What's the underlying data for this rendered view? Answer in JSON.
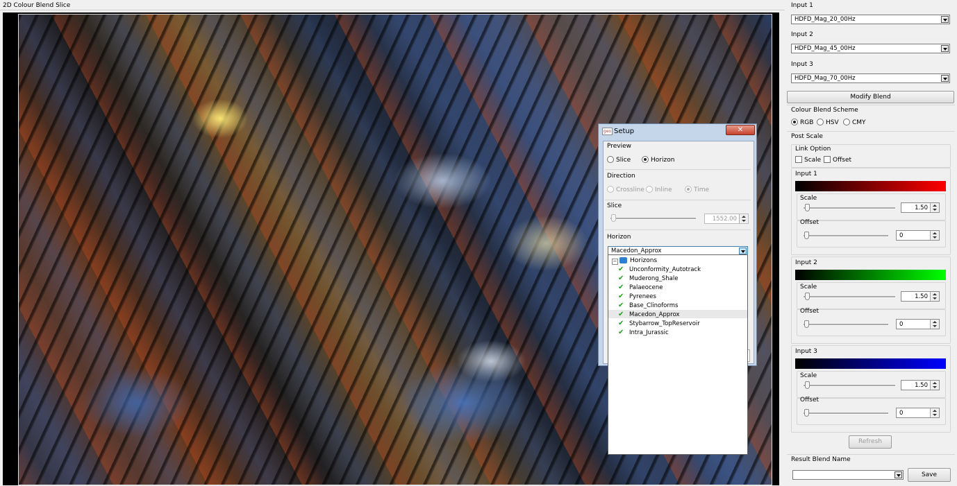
{
  "viewer": {
    "title": "2D Colour Blend Slice"
  },
  "inputs": [
    {
      "label": "Input 1",
      "value": "HDFD_Mag_20_00Hz"
    },
    {
      "label": "Input 2",
      "value": "HDFD_Mag_45_00Hz"
    },
    {
      "label": "Input 3",
      "value": "HDFD_Mag_70_00Hz"
    }
  ],
  "modify_blend": "Modify Blend",
  "scheme": {
    "title": "Colour Blend Scheme",
    "options": [
      "RGB",
      "HSV",
      "CMY"
    ],
    "selected": "RGB"
  },
  "post_scale": {
    "title": "Post Scale",
    "link_option": {
      "title": "Link Option",
      "scale": "Scale",
      "offset": "Offset"
    },
    "channels": [
      {
        "label": "Input 1",
        "scale_label": "Scale",
        "scale": "1.50",
        "offset_label": "Offset",
        "offset": "0",
        "color": "#ff0000"
      },
      {
        "label": "Input 2",
        "scale_label": "Scale",
        "scale": "1.50",
        "offset_label": "Offset",
        "offset": "0",
        "color": "#00ff00"
      },
      {
        "label": "Input 3",
        "scale_label": "Scale",
        "scale": "1.50",
        "offset_label": "Offset",
        "offset": "0",
        "color": "#0000ff"
      }
    ]
  },
  "refresh": "Refresh",
  "result": {
    "title": "Result Blend Name",
    "value": "",
    "save": "Save"
  },
  "setup": {
    "title": "Setup",
    "close": "✕",
    "preview": {
      "title": "Preview",
      "slice": "Slice",
      "horizon": "Horizon",
      "selected": "Horizon"
    },
    "direction": {
      "title": "Direction",
      "crossline": "Crossline",
      "inline": "Inline",
      "time": "Time"
    },
    "slice": {
      "title": "Slice",
      "value": "1552.00"
    },
    "horizon": {
      "title": "Horizon",
      "selected": "Macedon_Approx",
      "root": "Horizons",
      "items": [
        "Unconformity_Autotrack",
        "Muderong_Shale",
        "Palaeocene",
        "Pyrenees",
        "Base_Clinoforms",
        "Macedon_Approx",
        "Stybarrow_TopReservoir",
        "Intra_Jurassic"
      ]
    }
  }
}
